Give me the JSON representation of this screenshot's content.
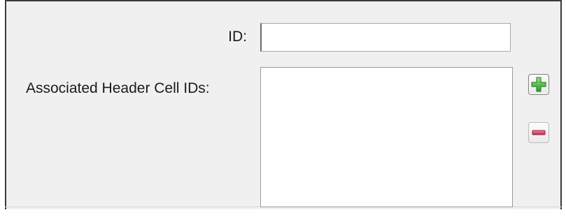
{
  "form": {
    "id_label": "ID:",
    "id_value": "",
    "associated_label": "Associated Header Cell IDs:",
    "associated_items": []
  },
  "buttons": {
    "add_icon": "plus-icon",
    "remove_icon": "minus-icon"
  },
  "colors": {
    "add_green": "#3fb53a",
    "remove_red": "#c2385a",
    "panel_bg": "#f0f0f0"
  }
}
